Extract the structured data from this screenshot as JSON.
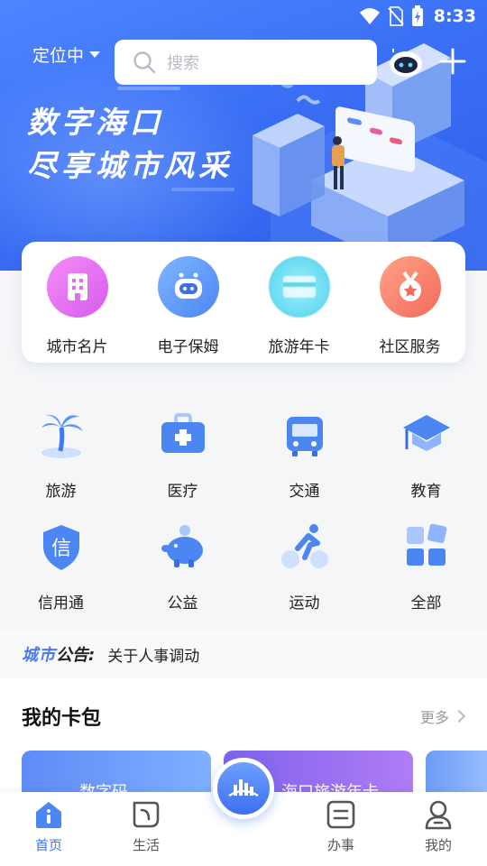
{
  "status": {
    "time": "8:33"
  },
  "header": {
    "location_label": "定位中",
    "search_placeholder": "搜索",
    "slogan_line1": "数字海口",
    "slogan_line2": "尽享城市风采"
  },
  "quick_links": [
    {
      "label": "城市名片",
      "icon": "building-icon",
      "color": "#e96bf0"
    },
    {
      "label": "电子保姆",
      "icon": "robot-icon",
      "color": "#5b9af5"
    },
    {
      "label": "旅游年卡",
      "icon": "card-icon",
      "color": "#4fd5ea"
    },
    {
      "label": "社区服务",
      "icon": "medal-icon",
      "color": "#f57a6a"
    }
  ],
  "services": [
    {
      "label": "旅游",
      "icon": "palm-tree-icon"
    },
    {
      "label": "医疗",
      "icon": "medical-kit-icon"
    },
    {
      "label": "交通",
      "icon": "bus-icon"
    },
    {
      "label": "教育",
      "icon": "graduation-cap-icon"
    },
    {
      "label": "信用通",
      "icon": "credit-shield-icon",
      "glyph": "信"
    },
    {
      "label": "公益",
      "icon": "piggy-bank-icon"
    },
    {
      "label": "运动",
      "icon": "cycling-icon"
    },
    {
      "label": "全部",
      "icon": "all-grid-icon"
    }
  ],
  "notice": {
    "tag_part1": "城市",
    "tag_part2": "公告:",
    "text": "关于人事调动"
  },
  "wallet": {
    "title": "我的卡包",
    "more_label": "更多",
    "cards": [
      "数字码",
      "海口旅游年卡"
    ]
  },
  "tabbar": [
    {
      "label": "首页",
      "icon": "home-icon",
      "active": true
    },
    {
      "label": "生活",
      "icon": "leaf-icon",
      "active": false
    },
    {
      "label": "办事",
      "icon": "tasks-icon",
      "active": false
    },
    {
      "label": "我的",
      "icon": "user-icon",
      "active": false
    }
  ],
  "colors": {
    "primary": "#3d73ef",
    "hero_start": "#4d86ff",
    "hero_end": "#2d5ee8"
  }
}
